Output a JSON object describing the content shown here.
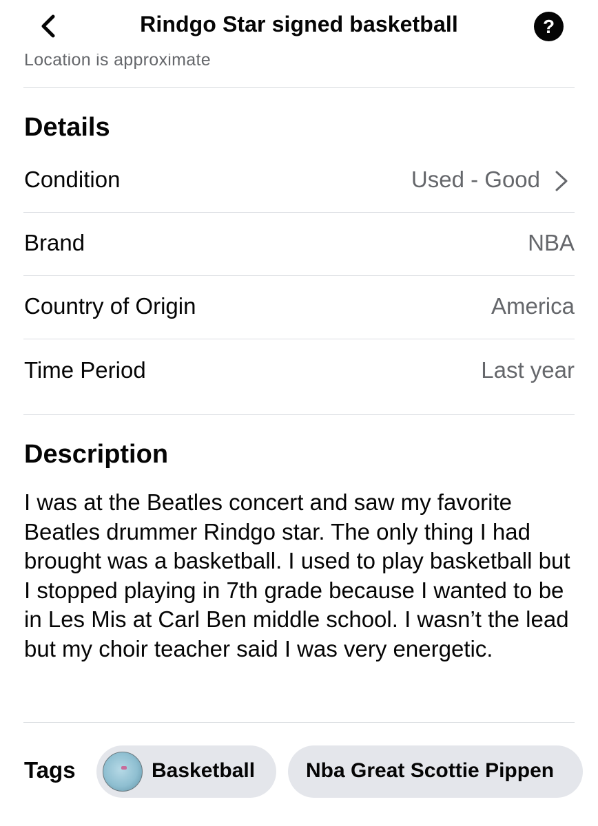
{
  "header": {
    "title": "Rindgo Star signed basketball",
    "help_glyph": "?"
  },
  "location_note": "Location is approximate",
  "details": {
    "heading": "Details",
    "rows": [
      {
        "label": "Condition",
        "value": "Used - Good",
        "chevron": true
      },
      {
        "label": "Brand",
        "value": "NBA"
      },
      {
        "label": "Country of Origin",
        "value": "America"
      },
      {
        "label": "Time Period",
        "value": "Last year"
      }
    ]
  },
  "description": {
    "heading": "Description",
    "text": "I was at the Beatles concert and saw my favorite Beatles drummer Rindgo star. The only thing I had brought was a basketball. I used to play basketball but I stopped playing in 7th grade because I wanted to be in Les Mis at Carl Ben middle school. I wasn’t the lead but my choir teacher said I was very energetic."
  },
  "tags": {
    "label": "Tags",
    "items": [
      {
        "label": "Basketball",
        "has_thumbnail": true
      },
      {
        "label": "Nba Great Scottie Pippen",
        "has_thumbnail": false
      }
    ]
  },
  "icons": {
    "back": "chevron-left-icon",
    "help": "question-mark-icon",
    "condition_chevron": "chevron-right-icon",
    "tag_thumbnail": "basketball-thumbnail"
  },
  "colors": {
    "primary_text": "#050505",
    "secondary_text": "#65676b",
    "divider": "#dadde1",
    "chip_background": "#e4e6eb"
  }
}
